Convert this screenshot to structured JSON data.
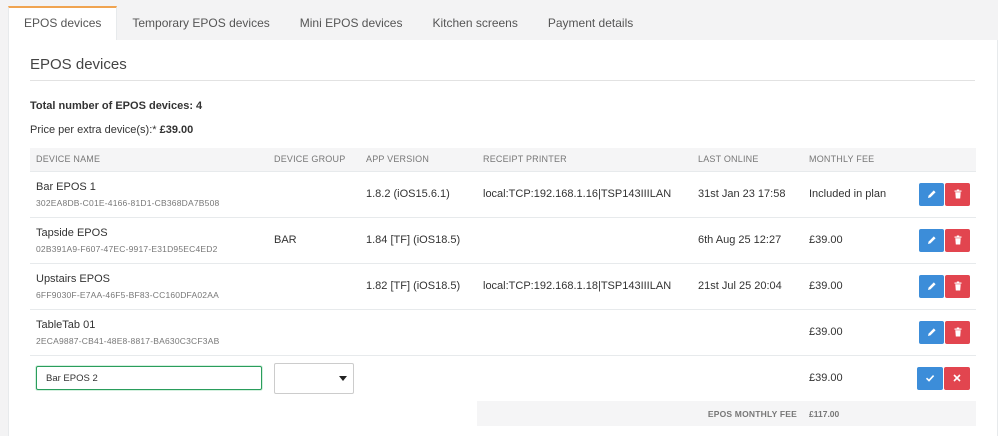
{
  "tabs": [
    {
      "label": "EPOS devices",
      "active": true
    },
    {
      "label": "Temporary EPOS devices",
      "active": false
    },
    {
      "label": "Mini EPOS devices",
      "active": false
    },
    {
      "label": "Kitchen screens",
      "active": false
    },
    {
      "label": "Payment details",
      "active": false
    }
  ],
  "panel": {
    "title": "EPOS devices",
    "total_label": "Total number of EPOS devices: 4",
    "price_label": "Price per extra device(s):*",
    "price_value": "£39.00"
  },
  "table": {
    "headers": {
      "device_name": "DEVICE NAME",
      "device_group": "DEVICE GROUP",
      "app_version": "APP VERSION",
      "receipt_printer": "RECEIPT PRINTER",
      "last_online": "LAST ONLINE",
      "monthly_fee": "MONTHLY FEE"
    },
    "rows": [
      {
        "name": "Bar EPOS 1",
        "id": "302EA8DB-C01E-4166-81D1-CB368DA7B508",
        "group": "",
        "version": "1.8.2 (iOS15.6.1)",
        "printer": "local:TCP:192.168.1.16|TSP143IIILAN",
        "last_online": "31st Jan 23 17:58",
        "fee": "Included in plan"
      },
      {
        "name": "Tapside EPOS",
        "id": "02B391A9-F607-47EC-9917-E31D95EC4ED2",
        "group": "BAR",
        "version": "1.84 [TF] (iOS18.5)",
        "printer": "",
        "last_online": "6th Aug 25 12:27",
        "fee": "£39.00"
      },
      {
        "name": "Upstairs EPOS",
        "id": "6FF9030F-E7AA-46F5-BF83-CC160DFA02AA",
        "group": "",
        "version": "1.82 [TF] (iOS18.5)",
        "printer": "local:TCP:192.168.1.18|TSP143IIILAN",
        "last_online": "21st Jul 25 20:04",
        "fee": "£39.00"
      },
      {
        "name": "TableTab 01",
        "id": "2ECA9887-CB41-48E8-8817-BA630C3CF3AB",
        "group": "",
        "version": "",
        "printer": "",
        "last_online": "",
        "fee": "£39.00"
      }
    ],
    "new_row": {
      "name_value": "Bar EPOS 2",
      "group_value": "",
      "fee": "£39.00"
    },
    "footer": {
      "label": "EPOS MONTHLY FEE",
      "value": "£117.00"
    }
  },
  "icons": {
    "edit": "pencil-icon",
    "delete": "trash-icon",
    "confirm": "check-icon",
    "cancel": "close-icon",
    "dropdown": "caret-down-icon"
  },
  "colors": {
    "tab_accent": "#f0a451",
    "edit_button": "#3c8dd9",
    "delete_button": "#e2454f",
    "input_focus": "#2a9d5c"
  }
}
